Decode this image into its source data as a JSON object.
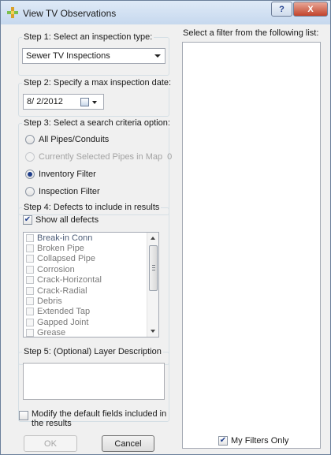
{
  "window": {
    "title": "View TV Observations",
    "help_label": "?",
    "close_label": "X"
  },
  "step1": {
    "label": "Step 1:  Select an inspection type:",
    "selected": "Sewer TV Inspections"
  },
  "step2": {
    "label": "Step 2:  Specify a max inspection date:",
    "date": "8/  2/2012"
  },
  "step3": {
    "label": "Step 3:  Select a search criteria option:",
    "options": [
      {
        "label": "All Pipes/Conduits",
        "checked": false,
        "enabled": true
      },
      {
        "label": "Currently Selected Pipes in Map",
        "checked": false,
        "enabled": false,
        "count": "0"
      },
      {
        "label": "Inventory Filter",
        "checked": true,
        "enabled": true
      },
      {
        "label": "Inspection Filter",
        "checked": false,
        "enabled": true
      }
    ]
  },
  "step4": {
    "label": "Step 4:  Defects to include in results",
    "show_all_label": "Show all defects",
    "show_all_checked": true,
    "defects": [
      "Break-in Conn",
      "Broken Pipe",
      "Collapsed Pipe",
      "Corrosion",
      "Crack-Horizontal",
      "Crack-Radial",
      "Debris",
      "Extended Tap",
      "Gapped Joint",
      "Grease"
    ]
  },
  "step5": {
    "label": "Step 5:  (Optional) Layer Description",
    "value": ""
  },
  "modify_fields": {
    "label_line1": "Modify the default fields included in",
    "label_line2": "the results",
    "checked": false
  },
  "buttons": {
    "ok": "OK",
    "cancel": "Cancel"
  },
  "filters": {
    "label": "Select a filter from the following list:",
    "items": [],
    "my_filters_label": "My Filters Only",
    "my_filters_checked": true
  },
  "colors": {
    "title_bar": "#c6d8ee",
    "close_button": "#c2432b",
    "face": "#f0f0f0"
  }
}
